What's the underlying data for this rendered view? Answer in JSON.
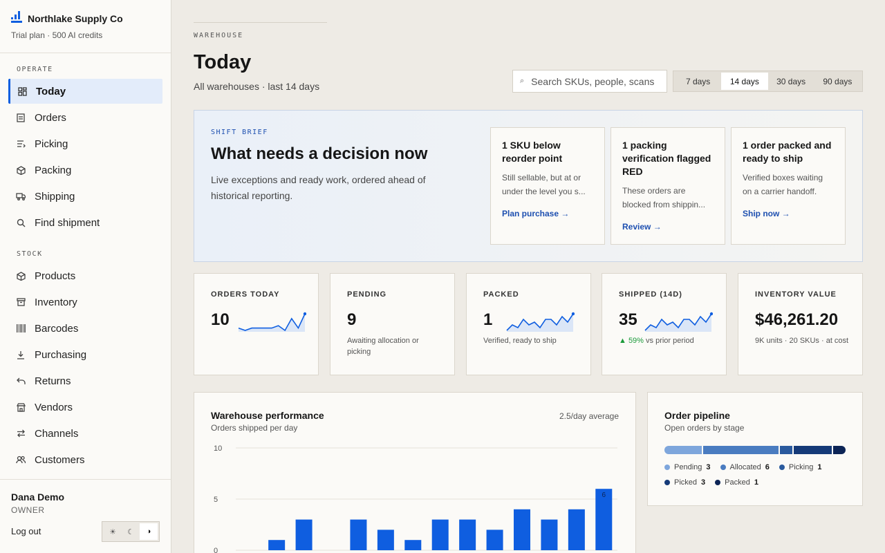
{
  "brand": {
    "name": "Northlake Supply Co",
    "plan": "Trial plan · 500 AI credits"
  },
  "nav": {
    "operate_label": "OPERATE",
    "stock_label": "STOCK",
    "items": [
      {
        "label": "Today",
        "icon": "dashboard-icon"
      },
      {
        "label": "Orders",
        "icon": "clipboard-icon"
      },
      {
        "label": "Picking",
        "icon": "list-icon"
      },
      {
        "label": "Packing",
        "icon": "box-icon"
      },
      {
        "label": "Shipping",
        "icon": "truck-icon"
      },
      {
        "label": "Find shipment",
        "icon": "search-icon"
      },
      {
        "label": "Products",
        "icon": "cube-icon"
      },
      {
        "label": "Inventory",
        "icon": "archive-icon"
      },
      {
        "label": "Barcodes",
        "icon": "barcode-icon"
      },
      {
        "label": "Purchasing",
        "icon": "download-icon"
      },
      {
        "label": "Returns",
        "icon": "return-icon"
      },
      {
        "label": "Vendors",
        "icon": "store-icon"
      },
      {
        "label": "Channels",
        "icon": "swap-icon"
      },
      {
        "label": "Customers",
        "icon": "users-icon"
      }
    ]
  },
  "user": {
    "name": "Dana Demo",
    "role": "OWNER",
    "logout": "Log out",
    "theme_options": [
      "☀",
      "☾",
      "◑"
    ]
  },
  "header": {
    "eyebrow": "WAREHOUSE",
    "title": "Today",
    "subtitle": "All warehouses · last 14 days"
  },
  "search": {
    "placeholder": "Search SKUs, people, scans"
  },
  "range": {
    "options": [
      "7 days",
      "14 days",
      "30 days",
      "90 days"
    ],
    "selected": "14 days"
  },
  "brief": {
    "tag": "SHIFT BRIEF",
    "title": "What needs a decision now",
    "text": "Live exceptions and ready work, ordered ahead of historical reporting.",
    "cards": [
      {
        "title": "1 SKU below reorder point",
        "desc_line1": "Still sellable, but at or",
        "desc_line2": "under the level you s...",
        "action": "Plan purchase →"
      },
      {
        "title": "1 packing verification flagged RED",
        "desc_line1": "These orders are",
        "desc_line2": "blocked from shippin...",
        "action": "Review →"
      },
      {
        "title": "1 order packed and ready to ship",
        "desc_line1": "Verified boxes waiting",
        "desc_line2": "on a carrier handoff.",
        "action": "Ship now →"
      }
    ]
  },
  "kpis": [
    {
      "label": "ORDERS TODAY",
      "value": "10",
      "note": "",
      "spark": [
        3,
        2,
        3,
        3,
        3,
        3,
        4,
        2,
        7,
        3,
        9
      ]
    },
    {
      "label": "PENDING",
      "value": "9",
      "note": "Awaiting allocation or picking"
    },
    {
      "label": "PACKED",
      "value": "1",
      "note": "Verified, ready to ship",
      "spark": [
        1,
        3,
        2,
        5,
        3,
        4,
        2,
        5,
        5,
        3,
        6,
        4,
        7
      ]
    },
    {
      "label": "SHIPPED (14D)",
      "value": "35",
      "delta": "▲ 59%",
      "note": "vs prior period",
      "spark": [
        1,
        3,
        2,
        5,
        3,
        4,
        2,
        5,
        5,
        3,
        6,
        4,
        7
      ]
    },
    {
      "label": "INVENTORY VALUE",
      "value": "$46,261.20",
      "note": "9K units · 20 SKUs · at cost"
    }
  ],
  "colors": {
    "accent": "#0f5ee0",
    "positive": "#1a9a3a",
    "bar": "#0f5ee0"
  },
  "performance": {
    "title": "Warehouse performance",
    "subtitle": "Orders shipped per day",
    "avg": "2.5/day average"
  },
  "chart_data": {
    "type": "bar",
    "values": [
      0,
      1,
      3,
      0,
      3,
      2,
      1,
      3,
      3,
      2,
      4,
      3,
      4,
      6
    ],
    "ylim": [
      0,
      10
    ],
    "yticks": [
      0,
      5,
      10
    ],
    "data_labels": {
      "13": "6"
    }
  },
  "pipeline": {
    "title": "Order pipeline",
    "subtitle": "Open orders by stage",
    "stages": [
      {
        "name": "Pending",
        "count": 3,
        "color": "#7ea6dc"
      },
      {
        "name": "Allocated",
        "count": 6,
        "color": "#4a7cc0"
      },
      {
        "name": "Picking",
        "count": 1,
        "color": "#2a5a9e"
      },
      {
        "name": "Picked",
        "count": 3,
        "color": "#153a78"
      },
      {
        "name": "Packed",
        "count": 1,
        "color": "#0c2456"
      }
    ]
  }
}
